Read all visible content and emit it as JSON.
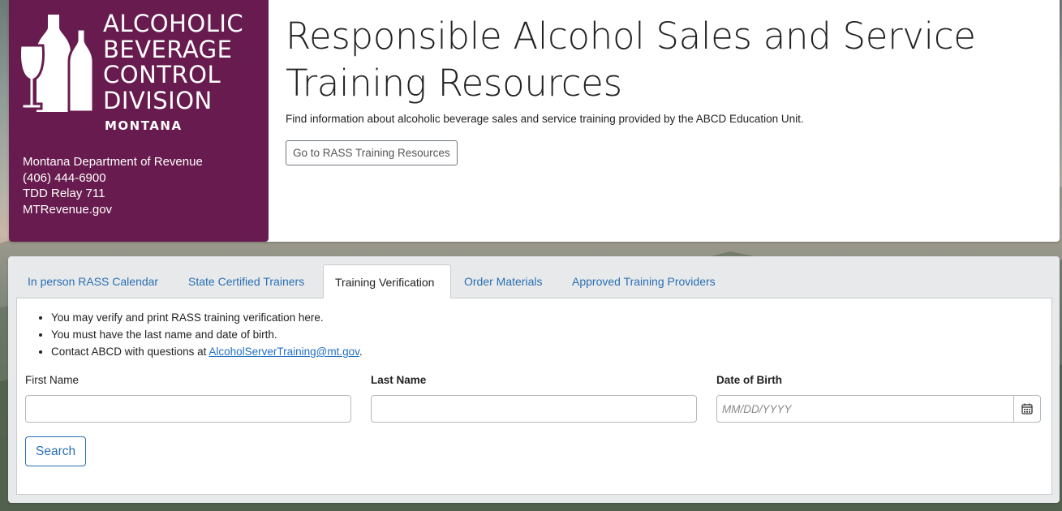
{
  "brand": {
    "logo_lines": [
      "ALCOHOLIC",
      "BEVERAGE",
      "CONTROL",
      "DIVISION"
    ],
    "logo_state": "MONTANA",
    "logo_icon": "wine-bottles-glass-icon",
    "brand_color": "#681b4e",
    "contact": {
      "org": "Montana Department of Revenue",
      "phone": "(406) 444-6900",
      "tdd": "TDD Relay 711",
      "website": "MTRevenue.gov"
    }
  },
  "header": {
    "title": "Responsible Alcohol Sales and Service Training Resources",
    "description": "Find information about alcoholic beverage sales and service training provided by the ABCD Education Unit.",
    "resources_button": "Go to RASS Training Resources"
  },
  "tabs": [
    {
      "label": "In person RASS Calendar",
      "active": false
    },
    {
      "label": "State Certified Trainers",
      "active": false
    },
    {
      "label": "Training Verification",
      "active": true
    },
    {
      "label": "Order Materials",
      "active": false
    },
    {
      "label": "Approved Training Providers",
      "active": false
    }
  ],
  "verification": {
    "bullets": [
      "You may verify and print RASS training verification here.",
      "You must have the last name and date of birth.",
      "Contact ABCD with questions at "
    ],
    "contact_email": "AlcoholServerTraining@mt.gov",
    "contact_suffix": ".",
    "first_name_label": "First Name",
    "first_name_value": "",
    "last_name_label": "Last Name",
    "last_name_value": "",
    "dob_label": "Date of Birth",
    "dob_placeholder": "MM/DD/YYYY",
    "dob_value": "",
    "calendar_icon": "calendar-icon",
    "search_button": "Search"
  },
  "colors": {
    "link": "#2a6fb5",
    "text": "#222222"
  }
}
